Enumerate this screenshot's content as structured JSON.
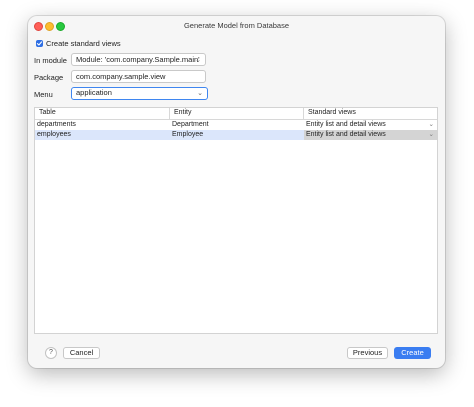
{
  "window": {
    "title": "Generate Model from Database"
  },
  "form": {
    "create_views_checkbox": {
      "label": "Create standard views",
      "checked": true
    },
    "module": {
      "label": "In module",
      "value": "Module: 'com.company.Sample.main'"
    },
    "package": {
      "label": "Package",
      "value": "com.company.sample.view"
    },
    "menu": {
      "label": "Menu",
      "value": "application"
    }
  },
  "table": {
    "columns": [
      "Table",
      "Entity",
      "Standard views"
    ],
    "rows": [
      {
        "table": "departments",
        "entity": "Department",
        "views": "Entity list and detail views",
        "selected": false
      },
      {
        "table": "employees",
        "entity": "Employee",
        "views": "Entity list and detail views",
        "selected": true
      }
    ]
  },
  "footer": {
    "help": "?",
    "cancel": "Cancel",
    "previous": "Previous",
    "create": "Create"
  },
  "colors": {
    "accent": "#3a7df1",
    "selection": "#dbe6fb"
  },
  "icons": {
    "dropdown": "chevron-down-icon",
    "checkmark": "checkmark-icon"
  }
}
